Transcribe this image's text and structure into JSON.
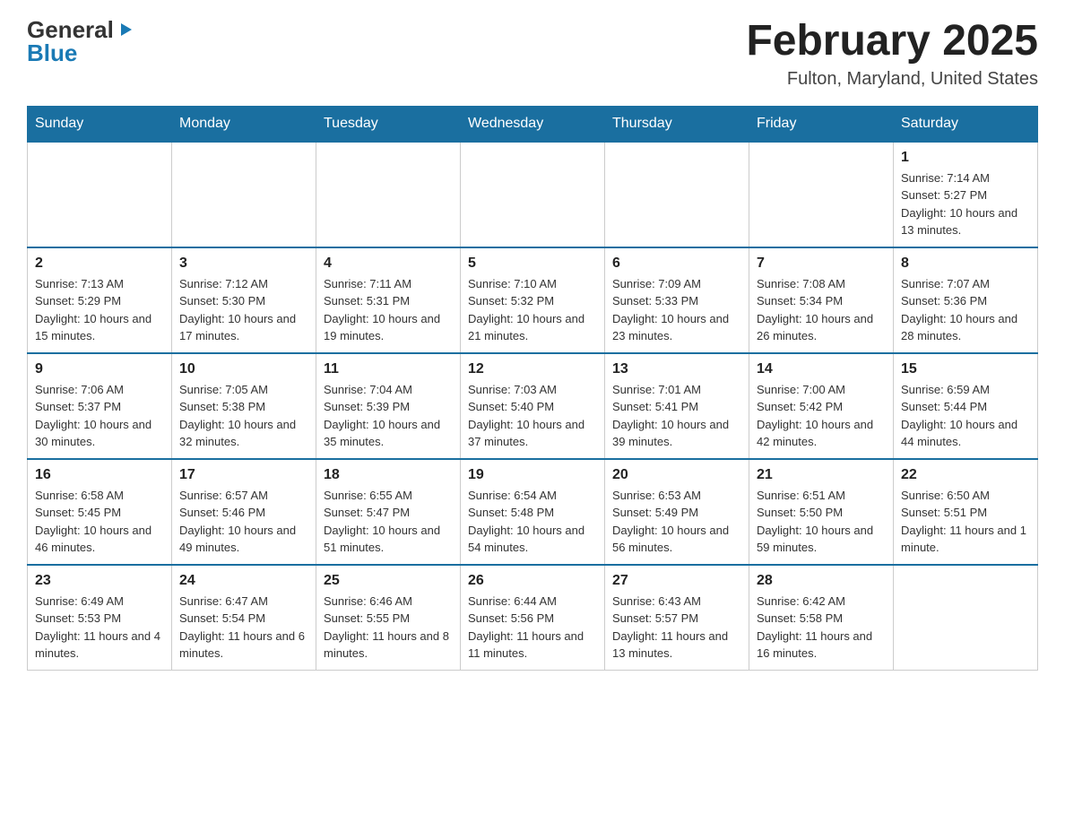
{
  "header": {
    "logo_general": "General",
    "logo_blue": "Blue",
    "month_title": "February 2025",
    "location": "Fulton, Maryland, United States"
  },
  "days_of_week": [
    "Sunday",
    "Monday",
    "Tuesday",
    "Wednesday",
    "Thursday",
    "Friday",
    "Saturday"
  ],
  "weeks": [
    [
      {
        "day": "",
        "info": ""
      },
      {
        "day": "",
        "info": ""
      },
      {
        "day": "",
        "info": ""
      },
      {
        "day": "",
        "info": ""
      },
      {
        "day": "",
        "info": ""
      },
      {
        "day": "",
        "info": ""
      },
      {
        "day": "1",
        "info": "Sunrise: 7:14 AM\nSunset: 5:27 PM\nDaylight: 10 hours and 13 minutes."
      }
    ],
    [
      {
        "day": "2",
        "info": "Sunrise: 7:13 AM\nSunset: 5:29 PM\nDaylight: 10 hours and 15 minutes."
      },
      {
        "day": "3",
        "info": "Sunrise: 7:12 AM\nSunset: 5:30 PM\nDaylight: 10 hours and 17 minutes."
      },
      {
        "day": "4",
        "info": "Sunrise: 7:11 AM\nSunset: 5:31 PM\nDaylight: 10 hours and 19 minutes."
      },
      {
        "day": "5",
        "info": "Sunrise: 7:10 AM\nSunset: 5:32 PM\nDaylight: 10 hours and 21 minutes."
      },
      {
        "day": "6",
        "info": "Sunrise: 7:09 AM\nSunset: 5:33 PM\nDaylight: 10 hours and 23 minutes."
      },
      {
        "day": "7",
        "info": "Sunrise: 7:08 AM\nSunset: 5:34 PM\nDaylight: 10 hours and 26 minutes."
      },
      {
        "day": "8",
        "info": "Sunrise: 7:07 AM\nSunset: 5:36 PM\nDaylight: 10 hours and 28 minutes."
      }
    ],
    [
      {
        "day": "9",
        "info": "Sunrise: 7:06 AM\nSunset: 5:37 PM\nDaylight: 10 hours and 30 minutes."
      },
      {
        "day": "10",
        "info": "Sunrise: 7:05 AM\nSunset: 5:38 PM\nDaylight: 10 hours and 32 minutes."
      },
      {
        "day": "11",
        "info": "Sunrise: 7:04 AM\nSunset: 5:39 PM\nDaylight: 10 hours and 35 minutes."
      },
      {
        "day": "12",
        "info": "Sunrise: 7:03 AM\nSunset: 5:40 PM\nDaylight: 10 hours and 37 minutes."
      },
      {
        "day": "13",
        "info": "Sunrise: 7:01 AM\nSunset: 5:41 PM\nDaylight: 10 hours and 39 minutes."
      },
      {
        "day": "14",
        "info": "Sunrise: 7:00 AM\nSunset: 5:42 PM\nDaylight: 10 hours and 42 minutes."
      },
      {
        "day": "15",
        "info": "Sunrise: 6:59 AM\nSunset: 5:44 PM\nDaylight: 10 hours and 44 minutes."
      }
    ],
    [
      {
        "day": "16",
        "info": "Sunrise: 6:58 AM\nSunset: 5:45 PM\nDaylight: 10 hours and 46 minutes."
      },
      {
        "day": "17",
        "info": "Sunrise: 6:57 AM\nSunset: 5:46 PM\nDaylight: 10 hours and 49 minutes."
      },
      {
        "day": "18",
        "info": "Sunrise: 6:55 AM\nSunset: 5:47 PM\nDaylight: 10 hours and 51 minutes."
      },
      {
        "day": "19",
        "info": "Sunrise: 6:54 AM\nSunset: 5:48 PM\nDaylight: 10 hours and 54 minutes."
      },
      {
        "day": "20",
        "info": "Sunrise: 6:53 AM\nSunset: 5:49 PM\nDaylight: 10 hours and 56 minutes."
      },
      {
        "day": "21",
        "info": "Sunrise: 6:51 AM\nSunset: 5:50 PM\nDaylight: 10 hours and 59 minutes."
      },
      {
        "day": "22",
        "info": "Sunrise: 6:50 AM\nSunset: 5:51 PM\nDaylight: 11 hours and 1 minute."
      }
    ],
    [
      {
        "day": "23",
        "info": "Sunrise: 6:49 AM\nSunset: 5:53 PM\nDaylight: 11 hours and 4 minutes."
      },
      {
        "day": "24",
        "info": "Sunrise: 6:47 AM\nSunset: 5:54 PM\nDaylight: 11 hours and 6 minutes."
      },
      {
        "day": "25",
        "info": "Sunrise: 6:46 AM\nSunset: 5:55 PM\nDaylight: 11 hours and 8 minutes."
      },
      {
        "day": "26",
        "info": "Sunrise: 6:44 AM\nSunset: 5:56 PM\nDaylight: 11 hours and 11 minutes."
      },
      {
        "day": "27",
        "info": "Sunrise: 6:43 AM\nSunset: 5:57 PM\nDaylight: 11 hours and 13 minutes."
      },
      {
        "day": "28",
        "info": "Sunrise: 6:42 AM\nSunset: 5:58 PM\nDaylight: 11 hours and 16 minutes."
      },
      {
        "day": "",
        "info": ""
      }
    ]
  ]
}
